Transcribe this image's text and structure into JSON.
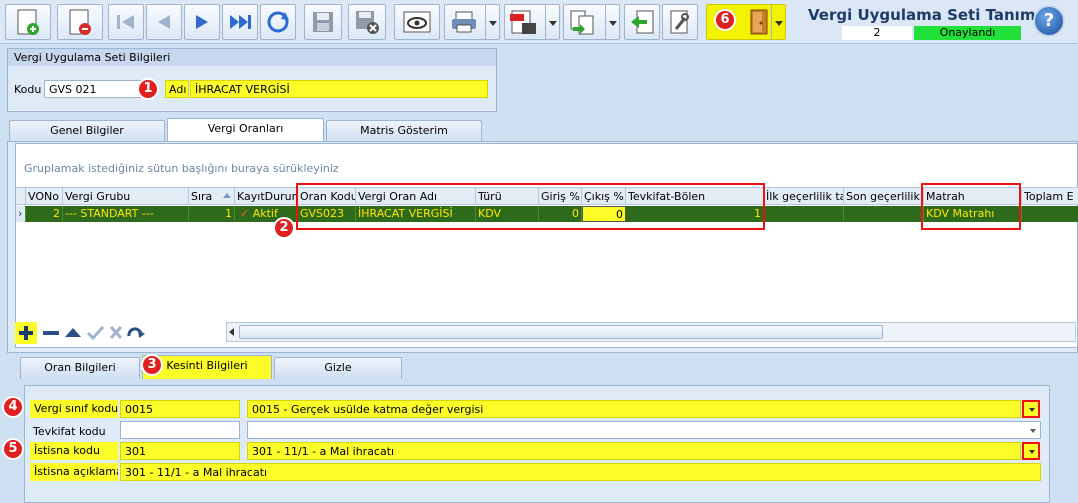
{
  "window": {
    "title": "Vergi Uygulama Seti Tanımı",
    "status_number": "2",
    "status_label": "Onaylandı",
    "status_color": "#22e03a"
  },
  "toolbar": {
    "icons": [
      "new-document-icon",
      "delete-document-icon",
      "first-record-icon",
      "previous-record-icon",
      "next-record-icon",
      "last-record-icon",
      "refresh-icon",
      "save-icon",
      "save-close-icon",
      "preview-icon",
      "print-icon",
      "pdf-icon",
      "copy-icon",
      "import-icon",
      "tools-icon",
      "exit-door-icon",
      "help-icon"
    ],
    "help_label": "?"
  },
  "set_info": {
    "header": "Vergi Uygulama Seti Bilgileri",
    "code_label": "Kodu",
    "code_value": "GVS 021",
    "name_label": "Adı",
    "name_value": "İHRACAT VERGİSİ"
  },
  "main_tabs": [
    {
      "label": "Genel Bilgiler"
    },
    {
      "label": "Vergi Oranları"
    },
    {
      "label": "Matris Gösterim"
    }
  ],
  "grid": {
    "group_hint": "Gruplamak istediğiniz sütun başlığını buraya sürükleyiniz",
    "columns": [
      "VONo",
      "Vergi Grubu",
      "Sıra",
      "KayıtDurumu",
      "Oran Kodu",
      "Vergi Oran Adı",
      "Türü",
      "Giriş %",
      "Çıkış %",
      "Tevkifat-Bölen",
      "İlk geçerlilik tarihi",
      "Son geçerlilik tarihi",
      "Matrah",
      "Toplam E"
    ],
    "row": {
      "vono": "2",
      "group": "--- STANDART ---",
      "order": "1",
      "status": "Aktif",
      "rate_code": "GVS023",
      "rate_name": "İHRACAT VERGİSİ",
      "type": "KDV",
      "in_pct": "0",
      "out_pct": "0",
      "withholding": "1",
      "first_valid": "",
      "last_valid": "",
      "base": "KDV Matrahı",
      "total": ""
    }
  },
  "sub_tabs": [
    {
      "label": "Oran Bilgileri"
    },
    {
      "label": "Kesinti Bilgileri"
    },
    {
      "label": "Gizle"
    }
  ],
  "deduction": {
    "tax_class_label": "Vergi sınıf kodu",
    "tax_class_code": "0015",
    "tax_class_desc": "0015 - Gerçek usülde katma değer vergisi",
    "withholding_label": "Tevkifat kodu",
    "withholding_code": "",
    "withholding_desc": "",
    "exemption_label": "İstisna kodu",
    "exemption_code": "301",
    "exemption_desc": "301 - 11/1 - a Mal ihracatı",
    "exemption_note_label": "İstisna açıklaması",
    "exemption_note": "301 - 11/1 - a Mal ihracatı"
  },
  "markers": [
    "1",
    "2",
    "3",
    "4",
    "5",
    "6"
  ]
}
